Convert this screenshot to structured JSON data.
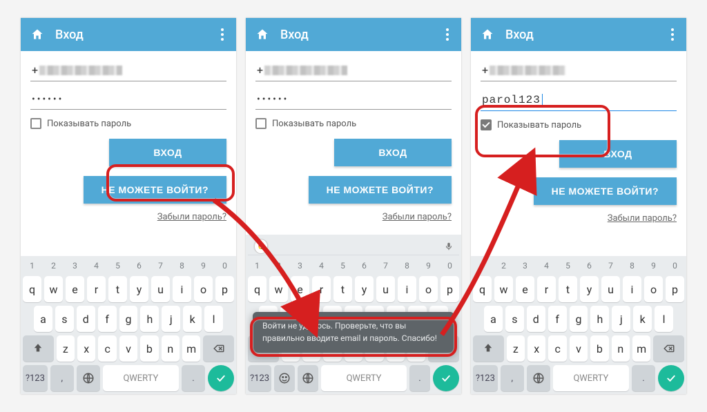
{
  "appbar": {
    "title": "Вход"
  },
  "form": {
    "phone_prefix": "+",
    "password_masked": "••••••",
    "password_plain": "parol123",
    "show_password_label": "Показывать пароль",
    "login_button": "ВХОД",
    "cant_login_button": "НЕ МОЖЕТЕ ВОЙТИ?",
    "forgot_link": "Забыли пароль?"
  },
  "toast": {
    "message": "Войти не удалось. Проверьте, что вы правильно вводите email и пароль. Спасибо!"
  },
  "keyboard": {
    "nums": [
      "1",
      "2",
      "3",
      "4",
      "5",
      "6",
      "7",
      "8",
      "9",
      "0"
    ],
    "row1": [
      "q",
      "w",
      "e",
      "r",
      "t",
      "y",
      "u",
      "i",
      "o",
      "p"
    ],
    "row2": [
      "a",
      "s",
      "d",
      "f",
      "g",
      "h",
      "j",
      "k",
      "l"
    ],
    "row3": [
      "z",
      "x",
      "c",
      "v",
      "b",
      "n",
      "m"
    ],
    "switch": "?123",
    "space": "QWERTY",
    "comma": ",",
    "period": "."
  }
}
